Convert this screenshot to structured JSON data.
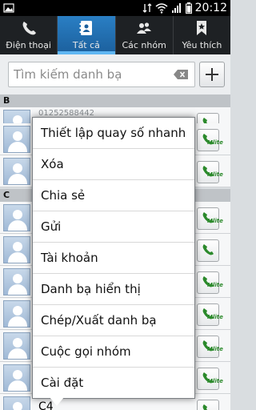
{
  "status_bar": {
    "time": "20:12",
    "icons": [
      "image-icon",
      "network-icon",
      "wifi-icon",
      "signal-icon",
      "battery-icon"
    ]
  },
  "tabs": [
    {
      "label": "Điện thoại",
      "icon": "phone-icon",
      "active": false
    },
    {
      "label": "Tất cả",
      "icon": "contacts-book-icon",
      "active": true
    },
    {
      "label": "Các nhóm",
      "icon": "group-icon",
      "active": false
    },
    {
      "label": "Yêu thích",
      "icon": "bookmark-star-icon",
      "active": false
    }
  ],
  "search": {
    "placeholder": "Tìm kiếm danh bạ"
  },
  "sections": [
    {
      "letter": "B"
    },
    {
      "letter": "C"
    }
  ],
  "list": {
    "first_row_number": "01252588442",
    "last_row_name": "C4"
  },
  "menu": {
    "items": [
      "Thiết lập quay số nhanh",
      "Xóa",
      "Chia sẻ",
      "Gửi",
      "Tài khoản",
      "Danh bạ hiển thị",
      "Chép/Xuất danh bạ",
      "Cuộc gọi nhóm",
      "Cài đặt"
    ]
  },
  "colors": {
    "active_tab": "#1b5f9c",
    "tab_bar": "#1e2124",
    "call_green": "#2c8a2c"
  }
}
